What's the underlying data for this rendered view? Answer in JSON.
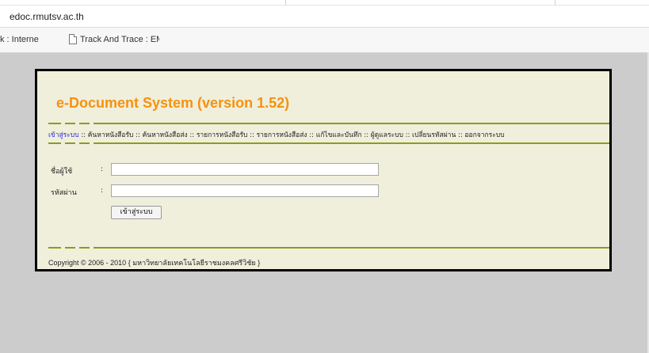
{
  "browser": {
    "url": "edoc.rmutsv.ac.th",
    "bookmarks": [
      {
        "label_main": "k : Interne",
        "label_fade": ""
      },
      {
        "label_main": "Track And Trace : EM",
        "label_fade": ""
      }
    ]
  },
  "app": {
    "title": "e-Document System (version 1.52)",
    "nav": {
      "items": [
        "เข้าสู่ระบบ",
        "ค้นหาหนังสือรับ",
        "ค้นหาหนังสือส่ง",
        "รายการหนังสือรับ",
        "รายการหนังสือส่ง",
        "แก้ไขและบันทึก",
        "ผู้ดูแลระบบ",
        "เปลี่ยนรหัสผ่าน",
        "ออกจากระบบ"
      ],
      "separator": "::"
    },
    "form": {
      "username_label": "ชื่อผู้ใช้",
      "password_label": "รหัสผ่าน",
      "colon": ":",
      "username_value": "",
      "password_value": "",
      "submit_label": "เข้าสู่ระบบ"
    },
    "footer": {
      "copyright": "Copyright © 2006 - 2010 { มหาวิทยาลัยเทคโนโลยีราชมงคลศรีวิชัย }"
    },
    "colors": {
      "title": "#f5910f",
      "panel_bg": "#efefdc",
      "rule": "#8c9b1f",
      "active_link": "#2c2cd6"
    }
  }
}
